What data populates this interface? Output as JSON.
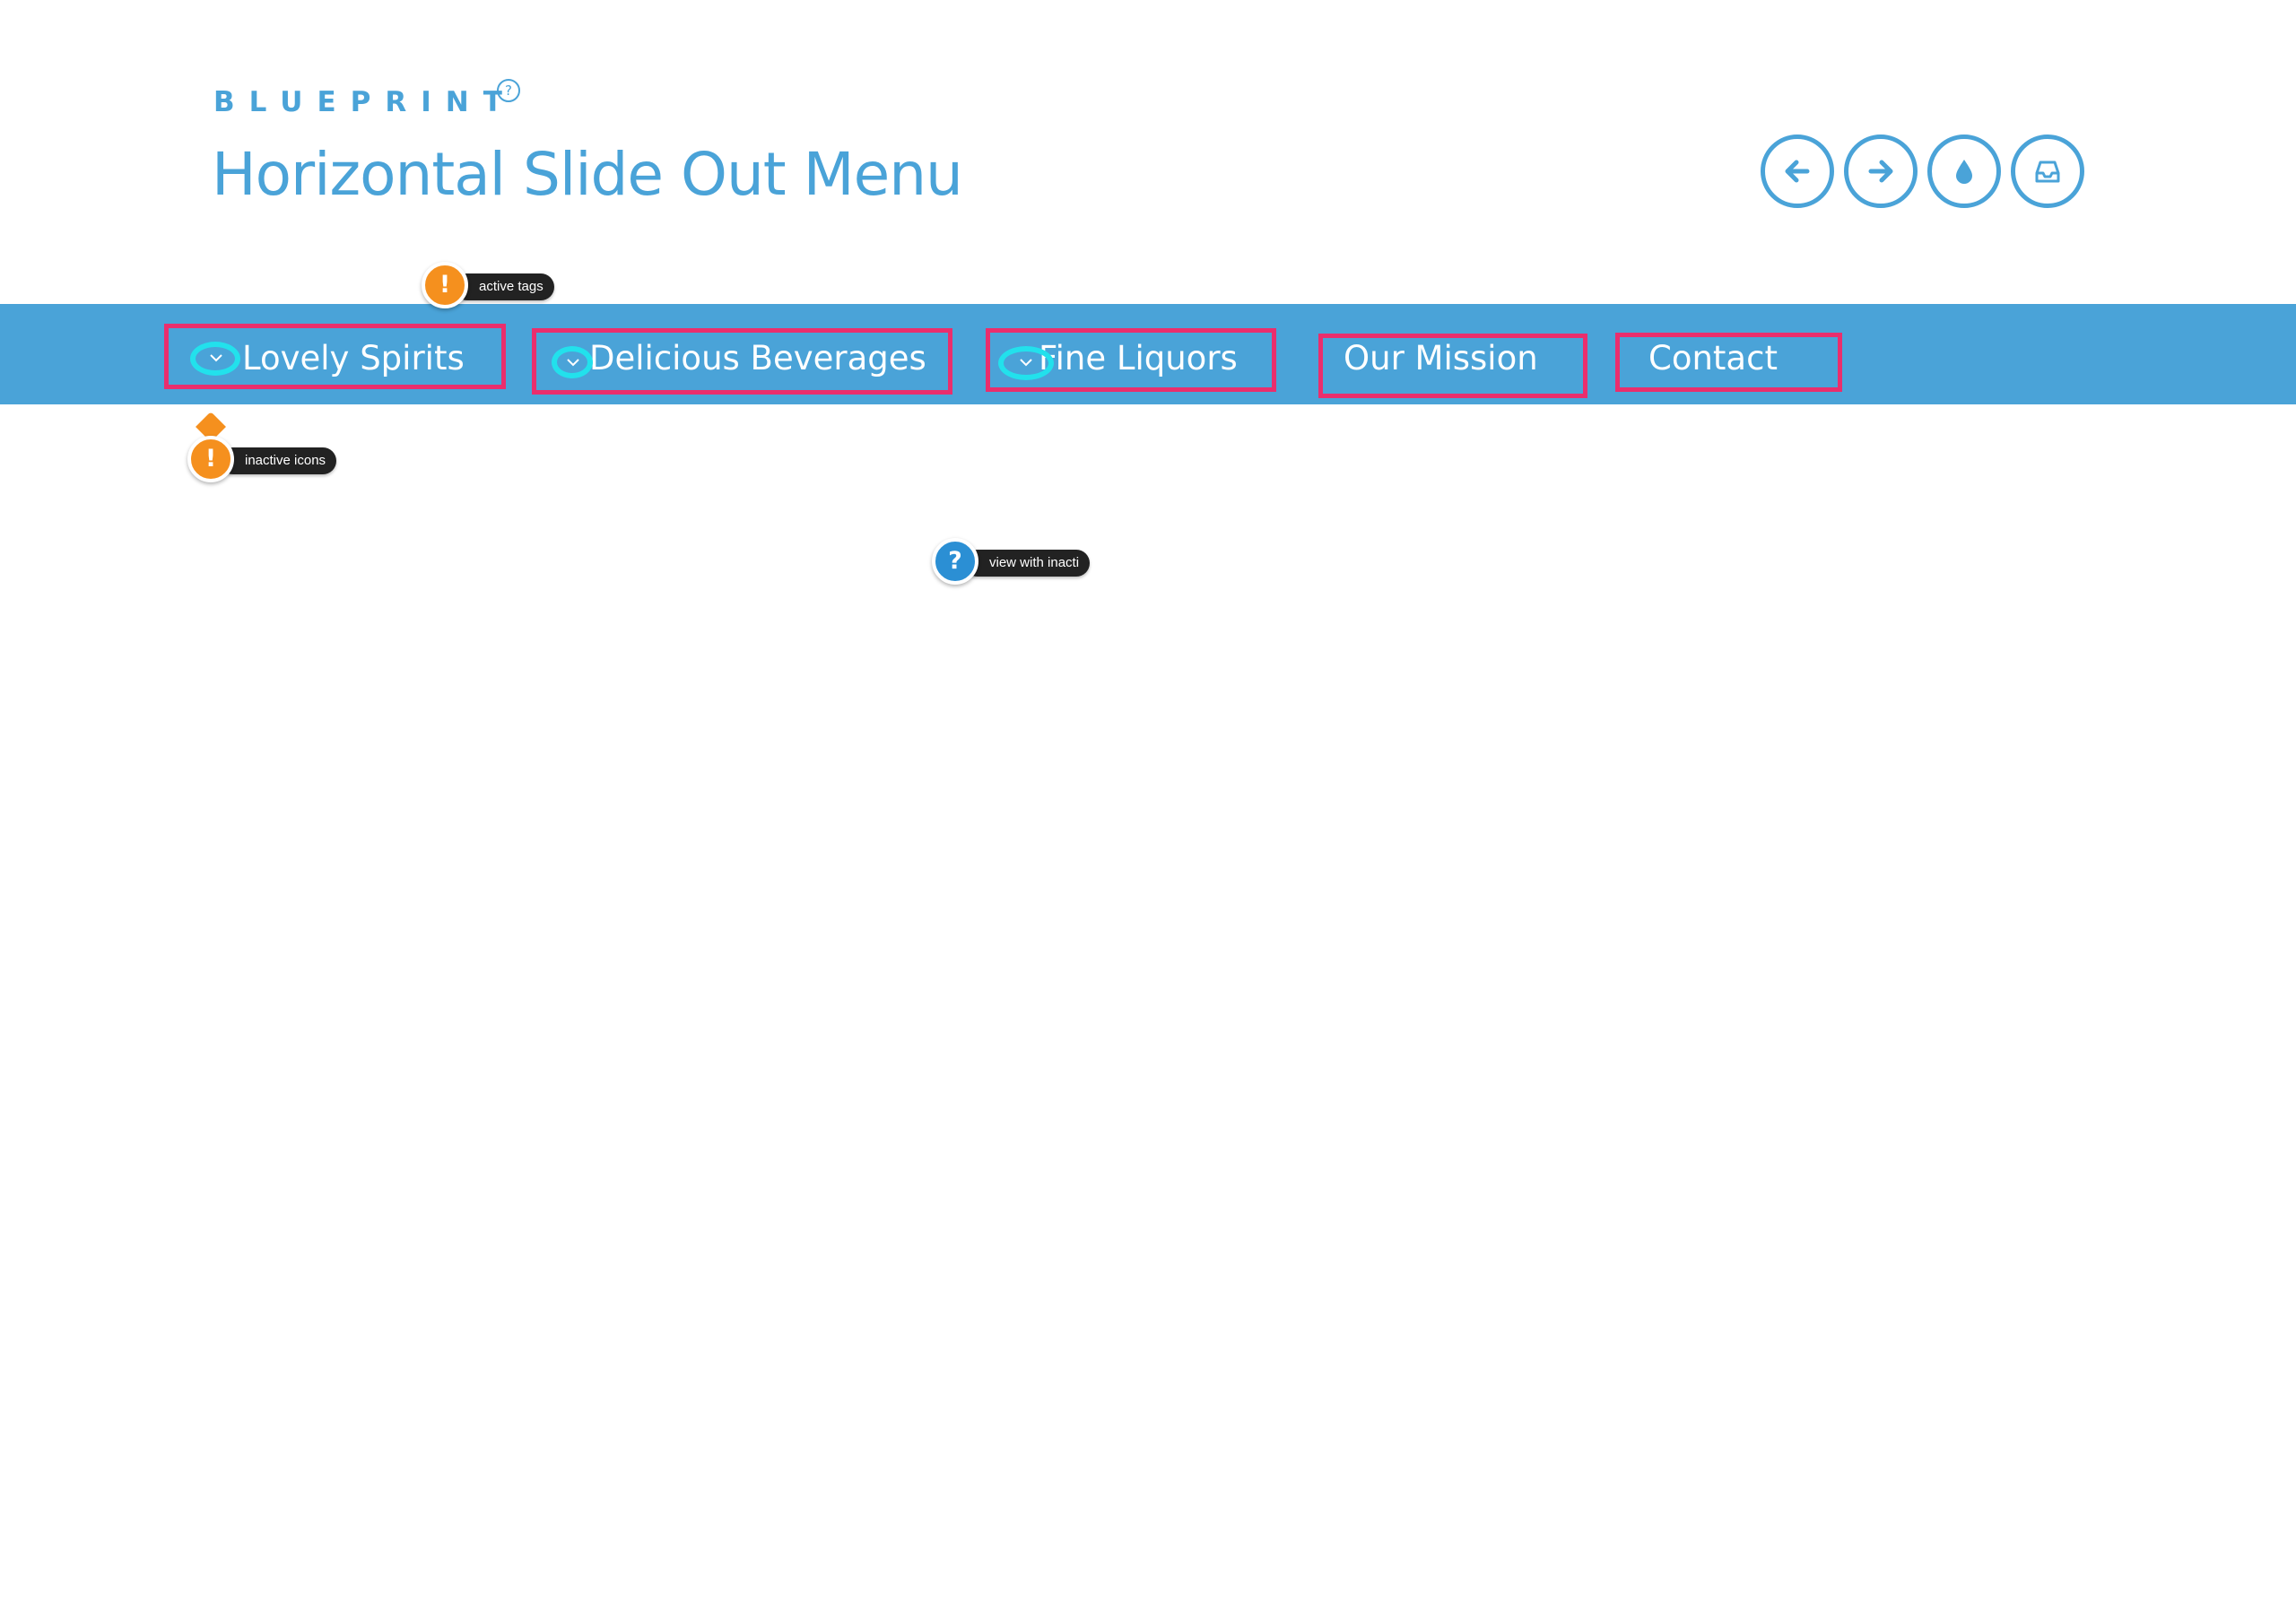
{
  "header": {
    "brand": "BLUEPRINT",
    "brand_mark": "?",
    "title": "Horizontal Slide Out Menu"
  },
  "toolbar": {
    "buttons": [
      {
        "icon": "arrow-left-icon"
      },
      {
        "icon": "arrow-right-icon"
      },
      {
        "icon": "drop-icon"
      },
      {
        "icon": "inbox-icon"
      }
    ]
  },
  "nav": {
    "items": [
      {
        "label": "Lovely Spirits",
        "has_submenu": true
      },
      {
        "label": "Delicious Beverages",
        "has_submenu": true
      },
      {
        "label": "Fine Liquors",
        "has_submenu": true
      },
      {
        "label": "Our Mission",
        "has_submenu": false
      },
      {
        "label": "Contact",
        "has_submenu": false
      }
    ]
  },
  "annotations": {
    "active_tags": {
      "badge": "!",
      "text": "active tags"
    },
    "inactive_icons": {
      "badge": "!",
      "text": "inactive icons"
    },
    "view_with": {
      "badge": "?",
      "text": "view with inacti"
    }
  },
  "colors": {
    "accent": "#4aa3d8",
    "highlight_box": "#ea2e6d",
    "highlight_circle": "#22e1ec",
    "warning": "#f5901e",
    "info": "#2b8fd4"
  }
}
